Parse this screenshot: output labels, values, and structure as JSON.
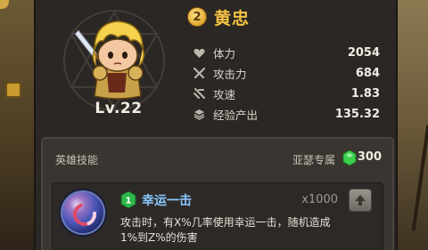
{
  "hero": {
    "rank": "2",
    "name": "黄忠",
    "level": "Lv.22",
    "avatar_icon": "blond-warrior-with-sword"
  },
  "stats": [
    {
      "icon": "heart-icon",
      "label": "体力",
      "value": "2054"
    },
    {
      "icon": "crossed-swords-icon",
      "label": "攻击力",
      "value": "684"
    },
    {
      "icon": "speed-swords-icon",
      "label": "攻速",
      "value": "1.83"
    },
    {
      "icon": "coin-stack-icon",
      "label": "经验产出",
      "value": "135.32"
    }
  ],
  "skills": {
    "title": "英雄技能",
    "exclusive_label": "亚瑟专属",
    "gem_count": "300",
    "skill": {
      "level": "1",
      "name": "幸运一击",
      "multiplier": "x1000",
      "description": "攻击时，有X%几率使用幸运一击，随机造成1%到Z%的伤害"
    }
  },
  "colors": {
    "hero_name": "#f6c443",
    "skill_name": "#8ac8ff",
    "gem": "#3ccf4e",
    "panel": "#2b2724"
  }
}
